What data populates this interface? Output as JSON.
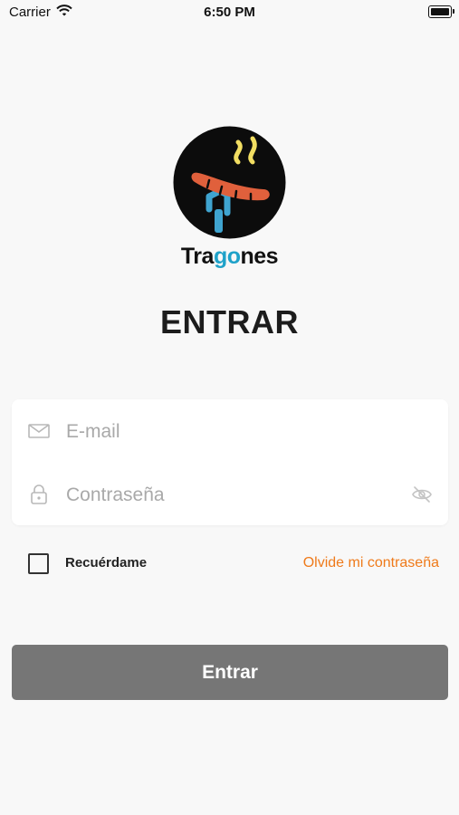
{
  "status_bar": {
    "carrier": "Carrier",
    "time": "6:50 PM"
  },
  "brand": {
    "name_prefix": "Tra",
    "name_highlight": "go",
    "name_suffix": "nes",
    "accent_color": "#1fa2c9"
  },
  "page": {
    "title": "ENTRAR"
  },
  "form": {
    "email": {
      "placeholder": "E-mail",
      "value": ""
    },
    "password": {
      "placeholder": "Contraseña",
      "value": ""
    },
    "remember_label": "Recuérdame",
    "forgot_label": "Olvide mi contraseña",
    "submit_label": "Entrar"
  },
  "colors": {
    "link": "#ef7a1a",
    "button": "#767676",
    "background": "#f8f8f8"
  },
  "icons": [
    "wifi-icon",
    "battery-icon",
    "mail-icon",
    "lock-icon",
    "eye-off-icon",
    "sausage-fork-logo"
  ]
}
